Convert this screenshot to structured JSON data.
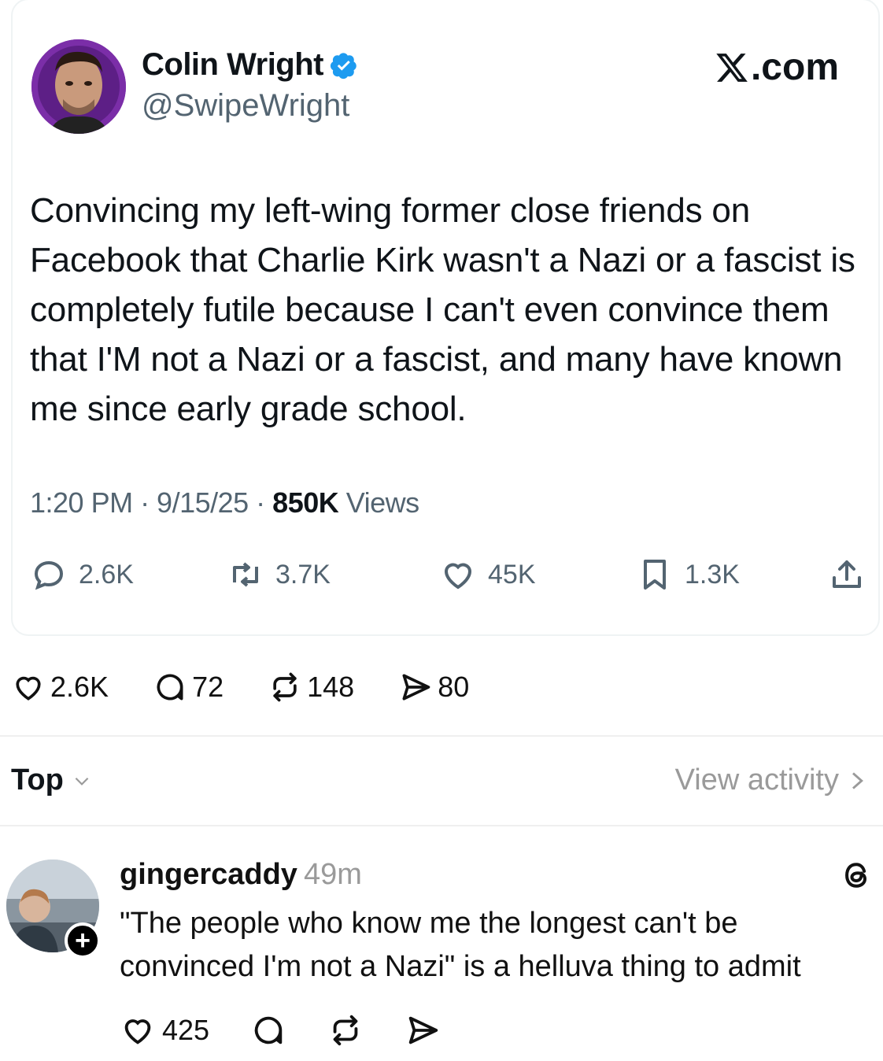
{
  "tweet": {
    "author_name": "Colin Wright",
    "author_handle": "@SwipeWright",
    "source_brand": ".com",
    "text": "Convincing my left-wing former close friends on Facebook that Charlie Kirk wasn't a Nazi or a fascist is completely futile because I can't even convince them that I'M not a Nazi or a fascist, and many have known me since early grade school.",
    "time": "1:20 PM · 9/15/25 · ",
    "views_count": "850K",
    "views_label": " Views",
    "replies": "2.6K",
    "reposts": "3.7K",
    "likes": "45K",
    "bookmarks": "1.3K",
    "verified_color": "#1d9bf0"
  },
  "threads_post": {
    "likes": "2.6K",
    "replies": "72",
    "reposts": "148",
    "shares": "80"
  },
  "sort": {
    "label": "Top",
    "view_activity": "View activity"
  },
  "reply": {
    "username": "gingercaddy",
    "time": "49m",
    "text": "\"The people who know me the longest can't be convinced I'm not a Nazi\" is a helluva thing to admit",
    "likes": "425",
    "follow_badge": "+"
  },
  "icons": [
    "verified-badge-icon",
    "x-logo-icon",
    "reply-icon",
    "repost-icon",
    "heart-icon",
    "bookmark-icon",
    "share-icon",
    "comment-icon",
    "send-icon",
    "chevron-down-icon",
    "chevron-right-icon",
    "threads-logo-icon"
  ]
}
